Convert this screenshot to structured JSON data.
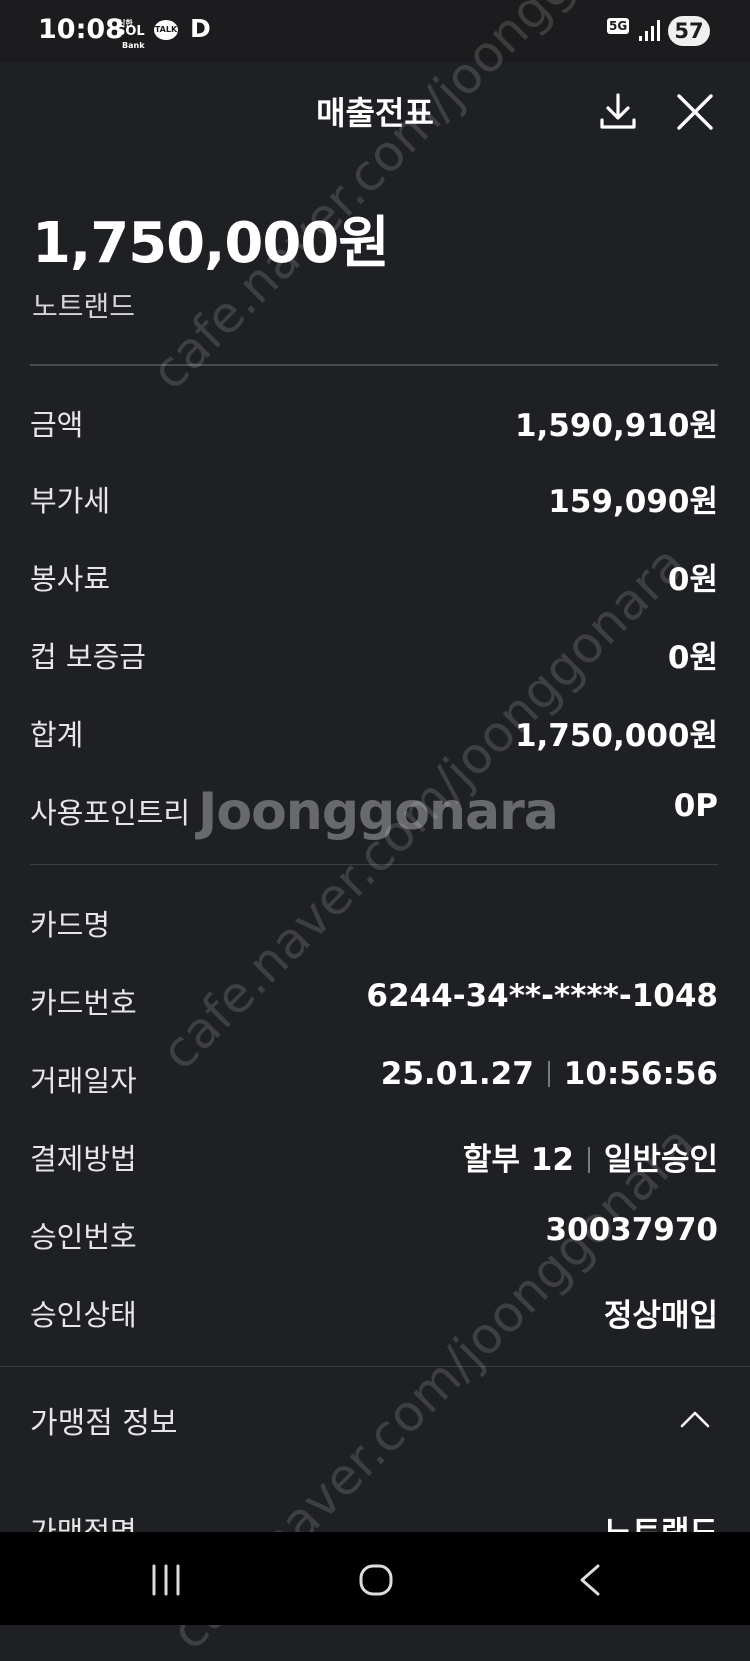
{
  "status_bar": {
    "time": "10:08",
    "app_sol_top": "신한",
    "app_sol_main": "SOL",
    "app_sol_bottom": "Bank",
    "app_talk": "TALK",
    "app_d": "D",
    "network": "5G",
    "battery": "57"
  },
  "header": {
    "title": "매출전표",
    "download_icon": "download-icon",
    "close_icon": "close-icon"
  },
  "summary": {
    "total_amount": "1,750,000원",
    "merchant_name": "노트랜드"
  },
  "amount_rows": [
    {
      "label": "금액",
      "value": "1,590,910원"
    },
    {
      "label": "부가세",
      "value": "159,090원"
    },
    {
      "label": "봉사료",
      "value": "0원"
    },
    {
      "label": "컵 보증금",
      "value": "0원"
    },
    {
      "label": "합계",
      "value": "1,750,000원"
    },
    {
      "label": "사용포인트리",
      "value": "0P"
    }
  ],
  "card_rows": {
    "card_name": {
      "label": "카드명",
      "value": ""
    },
    "card_number": {
      "label": "카드번호",
      "value": "6244-34**-****-1048"
    },
    "date": {
      "label": "거래일자",
      "date": "25.01.27",
      "time": "10:56:56"
    },
    "payment": {
      "label": "결제방법",
      "installment": "할부 12",
      "type": "일반승인"
    },
    "approval_no": {
      "label": "승인번호",
      "value": "30037970"
    },
    "approval_status": {
      "label": "승인상태",
      "value": "정상매입"
    }
  },
  "merchant_info": {
    "section_title": "가맹점 정보",
    "name_label": "가맹점명",
    "name_value": "노트랜드"
  },
  "watermark": {
    "url_text": "cafe.naver.com/joonggonara",
    "logo_text": "Joonggonara"
  }
}
